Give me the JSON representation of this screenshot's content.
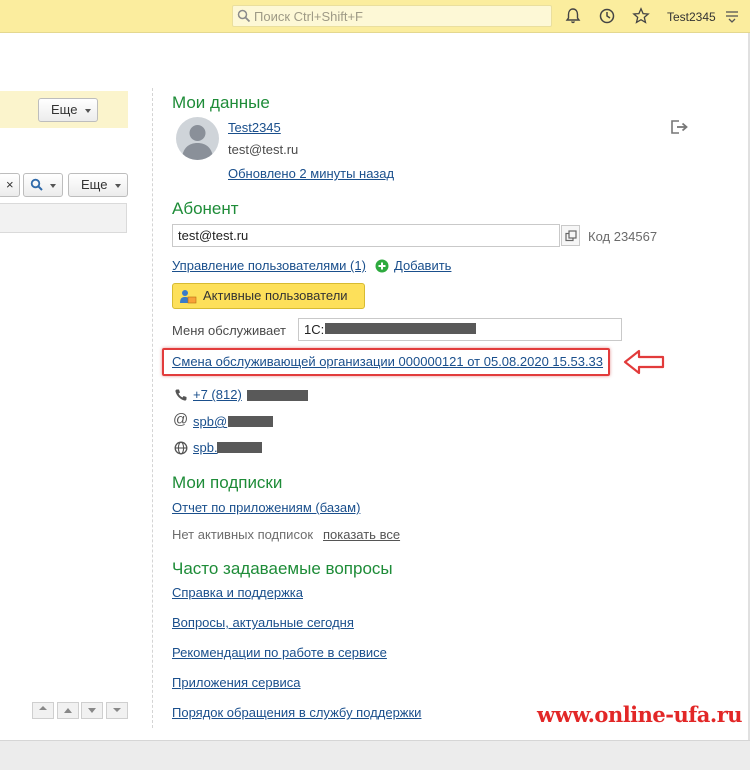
{
  "topbar": {
    "search_placeholder": "Поиск Ctrl+Shift+F",
    "user": "Test2345",
    "icons": [
      "search-icon",
      "bell-icon",
      "history-icon",
      "star-icon",
      "menu-icon"
    ]
  },
  "left_panel": {
    "more_label_1": "Еще",
    "more_label_2": "Еще",
    "clear_symbol": "×"
  },
  "my_data": {
    "title": "Мои данные",
    "username": "Test2345",
    "email": "test@test.ru",
    "updated": "Обновлено 2 минуты назад"
  },
  "subscriber": {
    "title": "Абонент",
    "field_value": "test@test.ru",
    "code_label": "Код 234567",
    "manage_users": "Управление пользователями (1)",
    "add": "Добавить",
    "active_users": "Активные пользователи",
    "served_by_label": "Меня обслуживает",
    "served_by_value": "1С:",
    "change_org": "Смена обслуживающей организации 000000121 от 05.08.2020 15.53.33",
    "phone": "+7 (812)",
    "email_contact": "spb@",
    "site": "spb."
  },
  "subscriptions": {
    "title": "Мои подписки",
    "report": "Отчет по приложениям (базам)",
    "none_active": "Нет активных подписок",
    "show_all": "показать все"
  },
  "faq": {
    "title": "Часто задаваемые вопросы",
    "links": [
      "Справка и поддержка",
      "Вопросы, актуальные сегодня",
      "Рекомендации по работе в сервисе",
      "Приложения сервиса",
      "Порядок обращения в службу поддержки"
    ]
  },
  "watermark": "www.online-ufa.ru",
  "colors": {
    "accent_green": "#1e8c38",
    "link_blue": "#1a4f8c",
    "topbar_yellow": "#fbed9e",
    "button_yellow": "#fde05a",
    "highlight_red": "#e23b3b"
  }
}
